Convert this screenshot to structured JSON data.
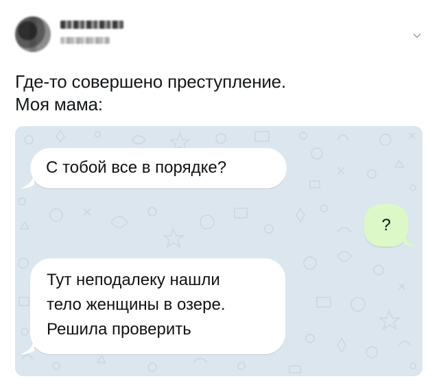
{
  "tweet": {
    "author_name": "",
    "author_handle": "",
    "menu_icon": "chevron-down-icon",
    "text_lines": [
      "Где-то совершено преступление.",
      "Моя мама:"
    ]
  },
  "chat": {
    "messages": [
      {
        "direction": "incoming",
        "lines": [
          "С тобой все в порядке?"
        ]
      },
      {
        "direction": "outgoing",
        "lines": [
          "?"
        ]
      },
      {
        "direction": "incoming",
        "lines": [
          "Тут неподалеку нашли",
          "тело женщины в озере.",
          "Решила проверить"
        ]
      }
    ],
    "colors": {
      "background": "#dce6ee",
      "incoming_bubble": "#ffffff",
      "outgoing_bubble": "#dcf8c6"
    }
  }
}
